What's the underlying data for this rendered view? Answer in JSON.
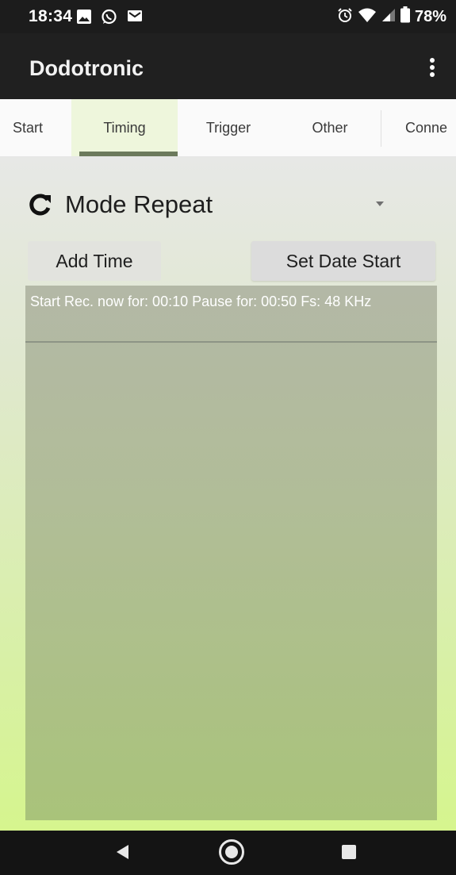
{
  "status_bar": {
    "time": "18:34",
    "battery": "78%",
    "left_icons": [
      "gallery-icon",
      "whatsapp-icon",
      "gmail-icon"
    ],
    "right_icons": [
      "alarm-icon",
      "wifi-icon",
      "cell-signal-icon",
      "battery-icon"
    ]
  },
  "app_bar": {
    "title": "Dodotronic",
    "menu_icon": "overflow-menu-icon"
  },
  "tabs": [
    {
      "label": "Start",
      "selected": false
    },
    {
      "label": "Timing",
      "selected": true
    },
    {
      "label": "Trigger",
      "selected": false
    },
    {
      "label": "Other",
      "selected": false
    },
    {
      "label": "Conne",
      "selected": false
    }
  ],
  "mode": {
    "icon": "repeat-icon",
    "label": "Mode Repeat"
  },
  "buttons": {
    "add_time": "Add Time",
    "set_date_start": "Set Date Start"
  },
  "schedule_list": [
    "Start Rec. now for: 00:10 Pause for: 00:50 Fs: 48 KHz"
  ],
  "nav_bar": {
    "icons": [
      "back-icon",
      "home-icon",
      "recents-icon"
    ]
  },
  "colors": {
    "tab_indicator": "#6c7a5c",
    "selected_tab_bg": "#eef6dc",
    "content_gradient_bottom": "#d6f58e"
  }
}
